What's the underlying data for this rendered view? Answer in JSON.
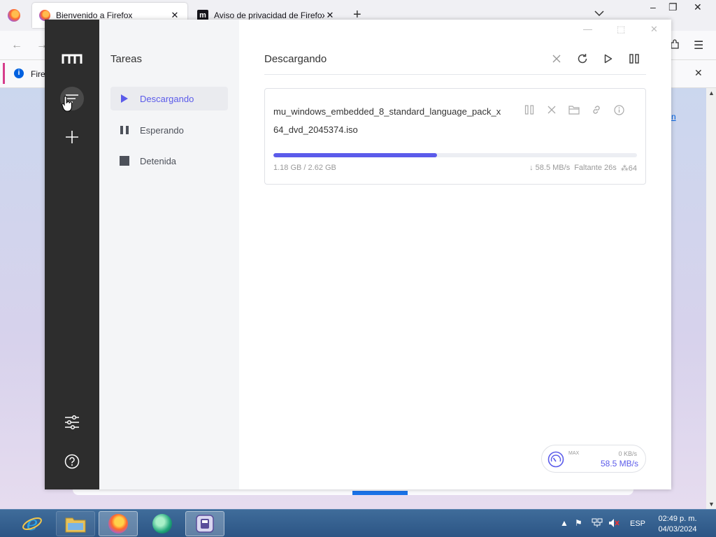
{
  "firefox": {
    "tabs": [
      {
        "label": "Bienvenido a Firefox",
        "active": true
      },
      {
        "label": "Aviso de privacidad de Firefox —",
        "active": false
      }
    ],
    "notice_text": "Fire",
    "content_link": "n"
  },
  "motrix": {
    "sidebar_title": "Tareas",
    "sidebar_items": [
      {
        "label": "Descargando",
        "icon": "play-icon",
        "active": true
      },
      {
        "label": "Esperando",
        "icon": "pause-icon",
        "active": false
      },
      {
        "label": "Detenida",
        "icon": "stop-icon",
        "active": false
      }
    ],
    "main_title": "Descargando",
    "task": {
      "name": "mu_windows_embedded_8_standard_language_pack_x64_dvd_2045374.iso",
      "progress": 0.45,
      "size_text": "1.18 GB / 2.62 GB",
      "speed": "58.5 MB/s",
      "remaining": "Faltante 26s",
      "connections": "64"
    },
    "speed_widget": {
      "max_label": "MAX",
      "upload": "0 KB/s",
      "download": "58.5 MB/s"
    },
    "accent": "#5b5bea"
  },
  "taskbar": {
    "language": "ESP",
    "time": "02:49 p. m.",
    "date": "04/03/2024"
  }
}
